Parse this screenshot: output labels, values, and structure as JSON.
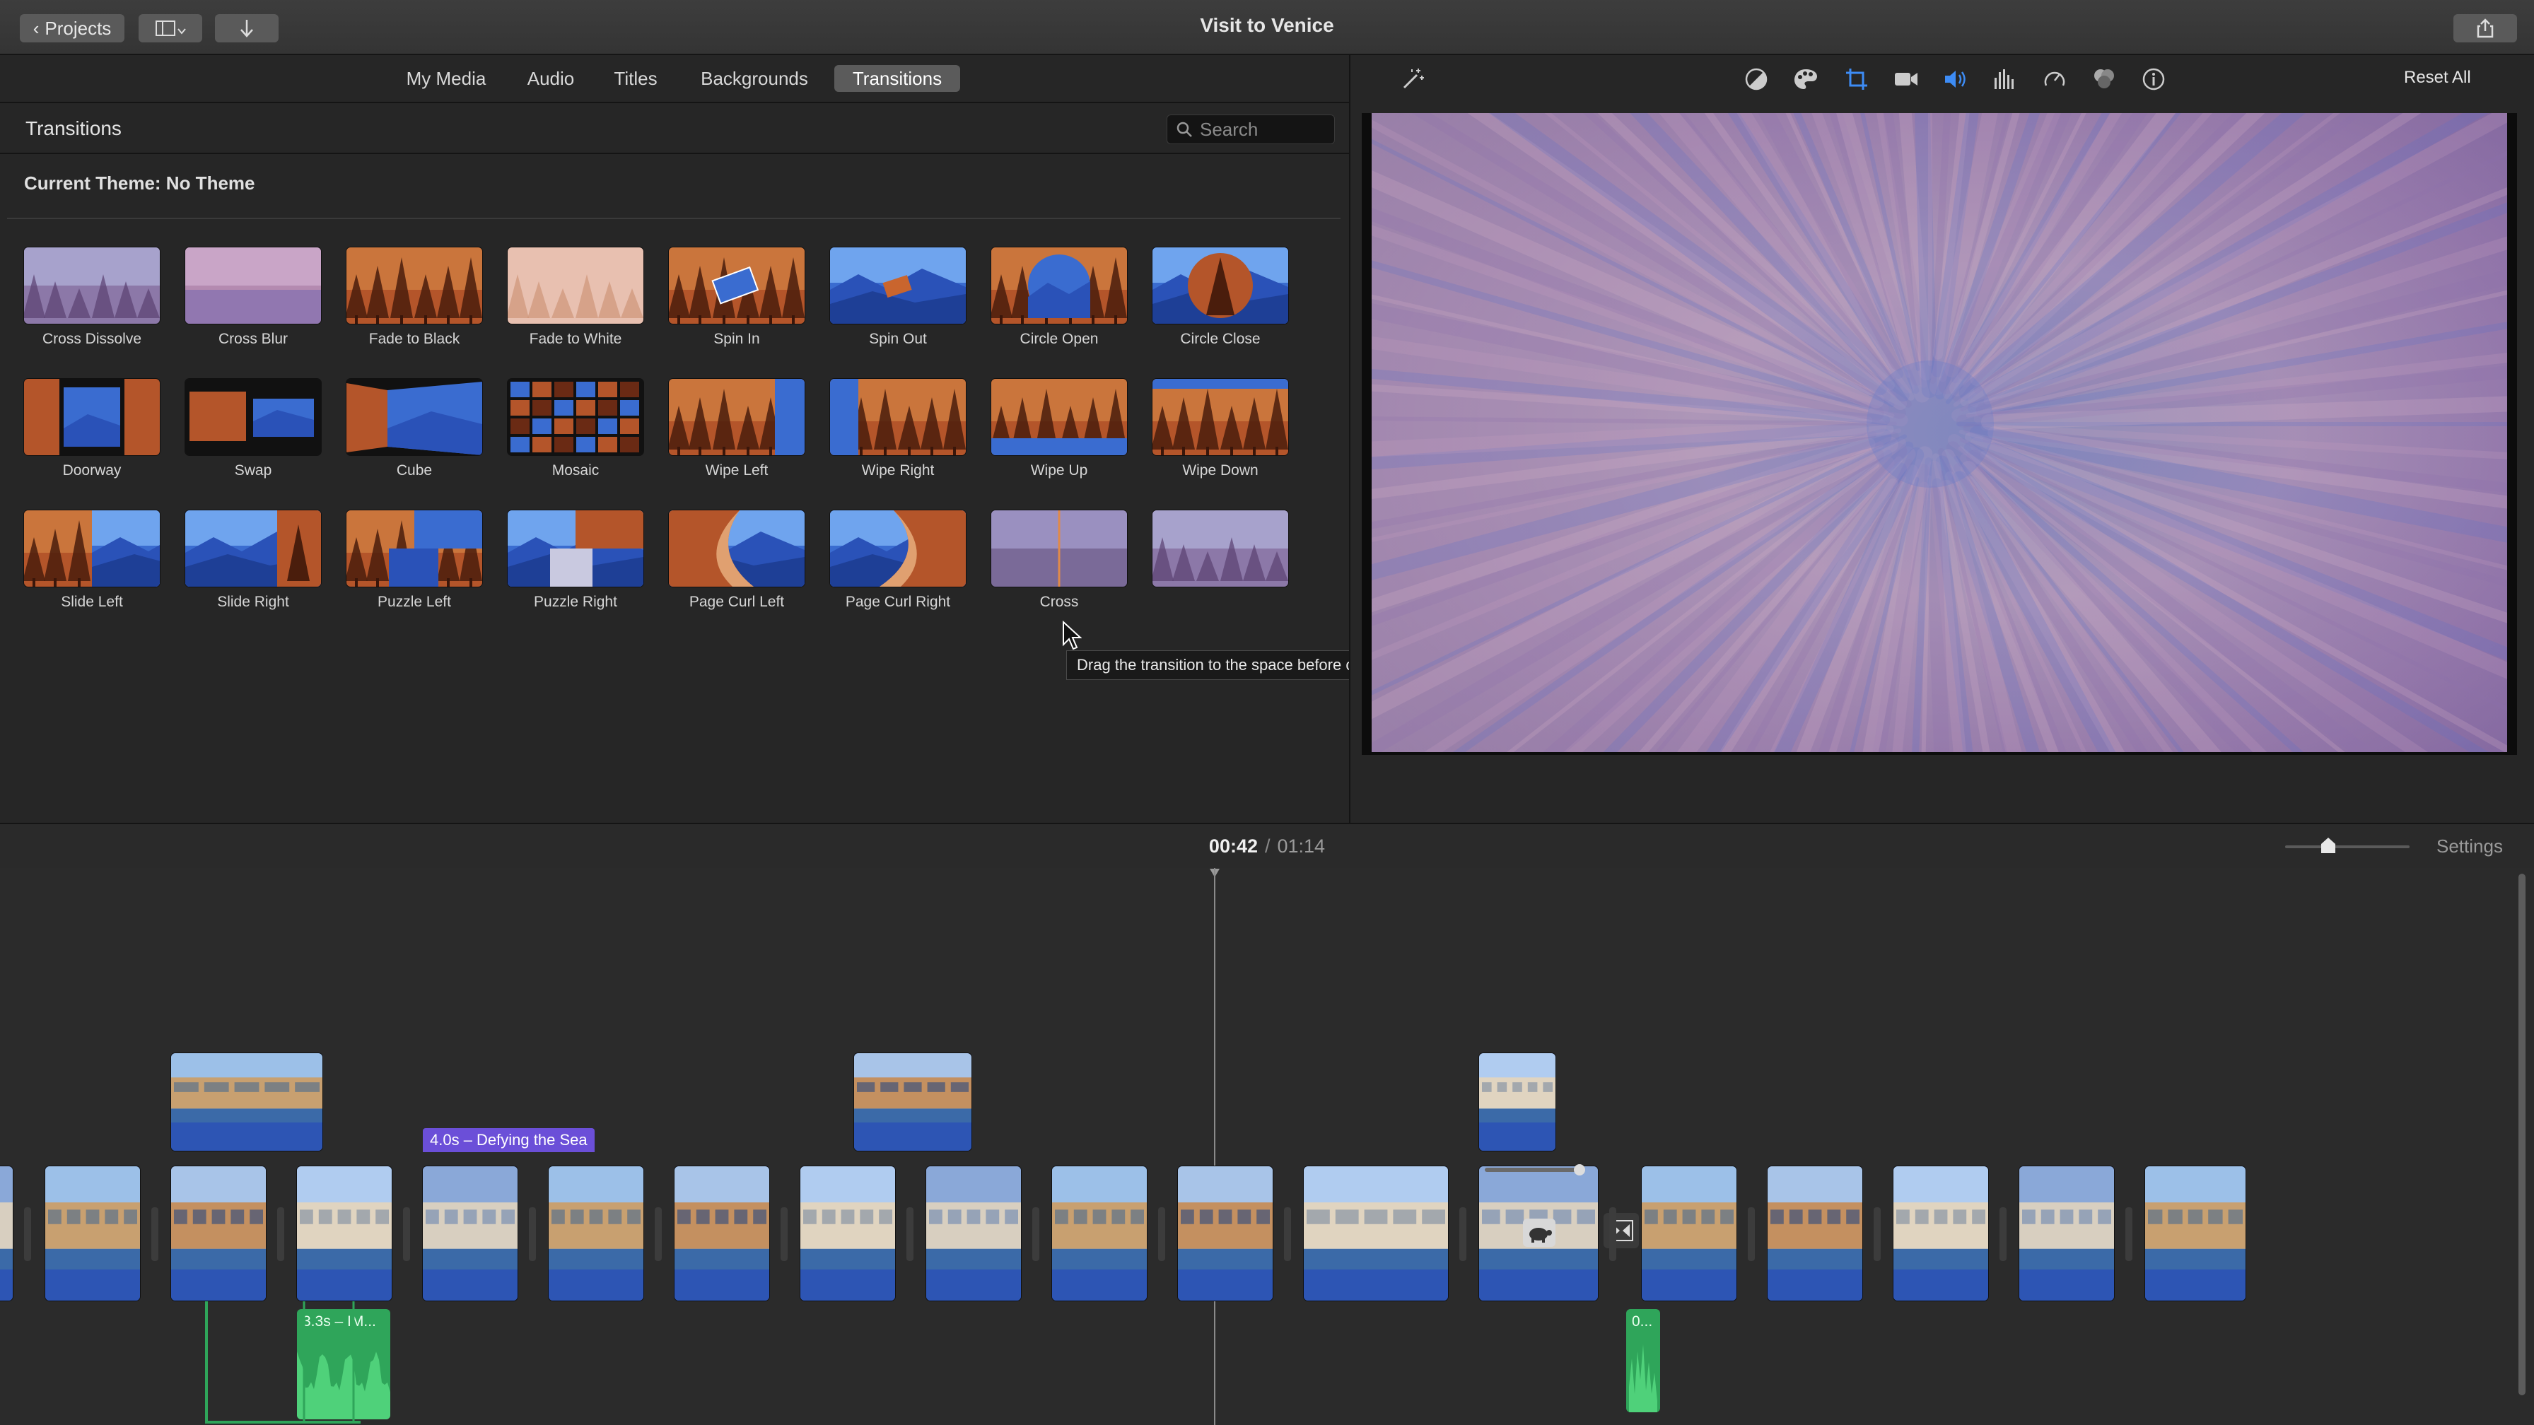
{
  "window": {
    "title": "Visit to Venice",
    "projects_label": "Projects"
  },
  "browser": {
    "tabs": [
      {
        "label": "My Media"
      },
      {
        "label": "Audio"
      },
      {
        "label": "Titles"
      },
      {
        "label": "Backgrounds"
      },
      {
        "label": "Transitions",
        "active": true
      }
    ],
    "panel_title": "Transitions",
    "search": {
      "placeholder": "Search",
      "value": ""
    },
    "theme_label": "Current Theme: No Theme",
    "transitions": [
      {
        "label": "Cross Dissolve",
        "style": "dissolve"
      },
      {
        "label": "Cross Blur",
        "style": "blur"
      },
      {
        "label": "Fade to Black",
        "style": "forest"
      },
      {
        "label": "Fade to White",
        "style": "white"
      },
      {
        "label": "Spin In",
        "style": "spin"
      },
      {
        "label": "Spin Out",
        "style": "spinout"
      },
      {
        "label": "Circle Open",
        "style": "circleopen"
      },
      {
        "label": "Circle Close",
        "style": "circleclose"
      },
      {
        "label": "Doorway",
        "style": "doorway"
      },
      {
        "label": "Swap",
        "style": "swap"
      },
      {
        "label": "Cube",
        "style": "cube"
      },
      {
        "label": "Mosaic",
        "style": "mosaic"
      },
      {
        "label": "Wipe Left",
        "style": "wipeleft"
      },
      {
        "label": "Wipe Right",
        "style": "wiperight"
      },
      {
        "label": "Wipe Up",
        "style": "wipeup"
      },
      {
        "label": "Wipe Down",
        "style": "wipedown"
      },
      {
        "label": "Slide Left",
        "style": "slideleft"
      },
      {
        "label": "Slide Right",
        "style": "slideright"
      },
      {
        "label": "Puzzle Left",
        "style": "puzzleleft"
      },
      {
        "label": "Puzzle Right",
        "style": "puzzleright"
      },
      {
        "label": "Page Curl Left",
        "style": "curlleft"
      },
      {
        "label": "Page Curl Right",
        "style": "curlright"
      },
      {
        "label": "Cross",
        "style": "crossbw"
      },
      {
        "label": "",
        "style": "dissolve"
      }
    ],
    "tooltip": "Drag the transition to the space before or after a clip"
  },
  "viewer": {
    "tools": [
      "magic-wand-icon",
      "color-balance-icon",
      "color-correction-icon",
      "crop-icon",
      "stabilization-icon",
      "volume-icon",
      "equalizer-icon",
      "speed-icon",
      "clip-filter-icon",
      "info-icon"
    ],
    "reset_label": "Reset All"
  },
  "timeline": {
    "current_time": "00:42",
    "separator": "/",
    "total_time": "01:14",
    "settings_label": "Settings",
    "zoom_level": 0.32,
    "title_clip_label": "4.0s – Defying the Sea",
    "audio_clips": [
      {
        "label": "3.3s – IM..."
      },
      {
        "label": "0..."
      }
    ]
  },
  "colors": {
    "accent": "#5b5b5b",
    "clip_band": "#2d55b4",
    "audio": "#2fa55a",
    "title_clip": "#6b4fd8"
  }
}
